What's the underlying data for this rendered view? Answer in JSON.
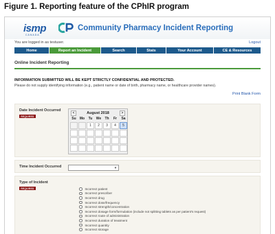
{
  "figure": {
    "title": "Figure 1. Reporting feature of the CPhIR program"
  },
  "header": {
    "logo_ismp": "ismp",
    "logo_ismp_sub": "CANADA",
    "logo_cpir": "CP",
    "title": "Community Pharmacy Incident Reporting"
  },
  "login": {
    "text": "You are logged in as testuser.",
    "logout": "Logout"
  },
  "nav": {
    "tabs": [
      "Home",
      "Report an Incident",
      "Search",
      "Stats",
      "Your Account",
      "CE & Resources"
    ]
  },
  "page": {
    "section_title": "Online Incident Reporting",
    "notice": "INFORMATION SUBMITTED WILL BE KEPT STRICTLY CONFIDENTIAL AND PROTECTED.",
    "notice_sub": "Please do not supply identifying information (e.g., patient name or date of birth, pharmacy name, or healthcare provider names).",
    "print_link": "Print Blank Form"
  },
  "form": {
    "date_label": "Date Incident Occurred",
    "required_label": "REQUIRED",
    "calendar": {
      "month": "August 2018",
      "prev": "<",
      "next": ">",
      "dows": [
        "Su",
        "Mo",
        "Tu",
        "We",
        "Th",
        "Fr",
        "Sa"
      ],
      "row1": [
        "1",
        "2",
        "3",
        "4",
        "5"
      ]
    },
    "time_label": "Time Incident Occurred",
    "time_value": "",
    "type_label": "Type of Incident",
    "type_options": [
      "Incorrect patient",
      "Incorrect prescriber",
      "Incorrect drug",
      "Incorrect dose/frequency",
      "Incorrect strength/concentration",
      "Incorrect dosage form/formulation (include not splitting tablets as per patient's request)",
      "Incorrect route of administration",
      "Incorrect duration of treatment",
      "Incorrect quantity",
      "Incorrect storage"
    ]
  },
  "colors": {
    "nav": "#1d5a8c",
    "nav_active": "#4a9a3a",
    "accent_rule": "#4a9a3a",
    "required": "#8b1414",
    "title_blue": "#2a6ebb"
  }
}
